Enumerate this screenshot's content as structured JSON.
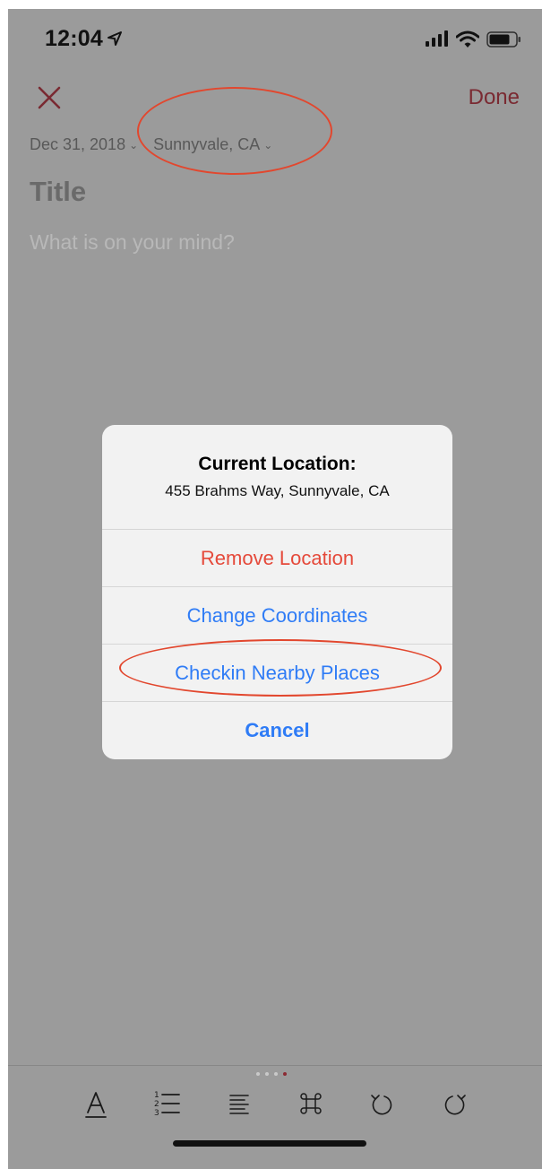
{
  "status_bar": {
    "time": "12:04"
  },
  "nav": {
    "close_icon": "close-icon",
    "done_label": "Done"
  },
  "entry": {
    "date": "Dec 31, 2018",
    "location": "Sunnyvale, CA",
    "chevron": "⌄",
    "title_placeholder": "Title",
    "body_placeholder": "What is on your mind?"
  },
  "alert": {
    "title": "Current Location:",
    "message": "455 Brahms Way, Sunnyvale, CA",
    "actions": [
      {
        "label": "Remove Location",
        "style": "destructive"
      },
      {
        "label": "Change Coordinates",
        "style": "default"
      },
      {
        "label": "Checkin Nearby Places",
        "style": "default"
      },
      {
        "label": "Cancel",
        "style": "cancel"
      }
    ]
  },
  "toolbar": {
    "page_count": 4,
    "active_page": 4,
    "tools": [
      "text-format-icon",
      "numbered-list-icon",
      "align-icon",
      "command-icon",
      "undo-icon",
      "redo-icon"
    ]
  },
  "colors": {
    "accent": "#7a2a32",
    "destructive": "#e5493a",
    "link": "#2f7cf6",
    "annotation": "#e2472e",
    "dimmed_background": "#9b9b9b"
  }
}
